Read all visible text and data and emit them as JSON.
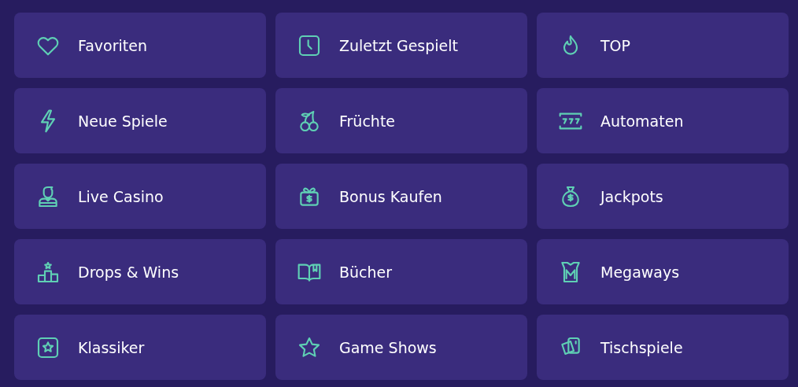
{
  "categories": [
    {
      "label": "Favoriten"
    },
    {
      "label": "Zuletzt Gespielt"
    },
    {
      "label": "TOP"
    },
    {
      "label": "Neue Spiele"
    },
    {
      "label": "Früchte"
    },
    {
      "label": "Automaten"
    },
    {
      "label": "Live Casino"
    },
    {
      "label": "Bonus Kaufen"
    },
    {
      "label": "Jackpots"
    },
    {
      "label": "Drops & Wins"
    },
    {
      "label": "Bücher"
    },
    {
      "label": "Megaways"
    },
    {
      "label": "Klassiker"
    },
    {
      "label": "Game Shows"
    },
    {
      "label": "Tischspiele"
    }
  ]
}
